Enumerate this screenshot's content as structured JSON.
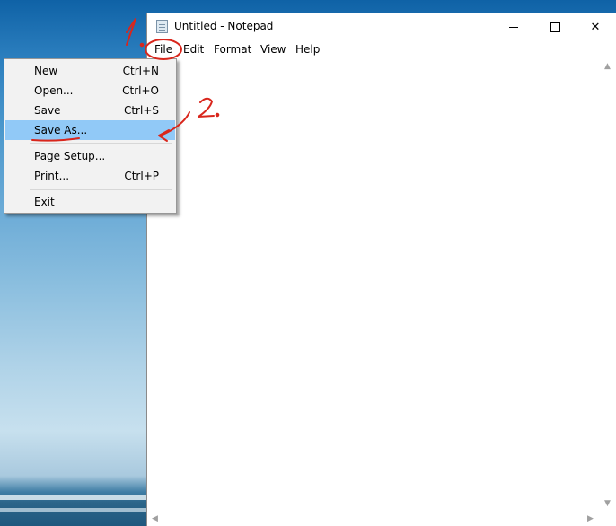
{
  "window": {
    "title": "Untitled - Notepad",
    "minimize_glyph": "",
    "maximize_glyph": "",
    "close_glyph": "✕"
  },
  "menubar": {
    "file": "File",
    "edit": "Edit",
    "format": "Format",
    "view": "View",
    "help": "Help"
  },
  "file_menu": {
    "items": [
      {
        "label": "New",
        "shortcut": "Ctrl+N"
      },
      {
        "label": "Open...",
        "shortcut": "Ctrl+O"
      },
      {
        "label": "Save",
        "shortcut": "Ctrl+S"
      },
      {
        "label": "Save As...",
        "shortcut": ""
      },
      {
        "label": "Page Setup...",
        "shortcut": ""
      },
      {
        "label": "Print...",
        "shortcut": "Ctrl+P"
      },
      {
        "label": "Exit",
        "shortcut": ""
      }
    ],
    "highlighted": "Save As..."
  },
  "editor": {
    "content": ""
  },
  "scrollbars": {
    "up_arrow": "▲",
    "down_arrow": "▼",
    "left_arrow": "◀",
    "right_arrow": "▶"
  },
  "annotations": {
    "step1": "1.",
    "step2": "2.",
    "color": "#d9261c"
  }
}
